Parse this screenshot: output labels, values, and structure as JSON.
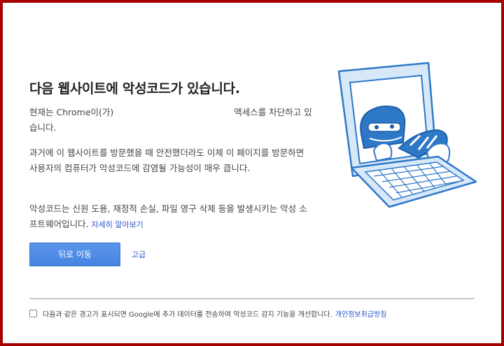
{
  "interstitial": {
    "title": "다음 웹사이트에 악성코드가 있습니다.",
    "paragraph1_part1": "현재는 Chrome이(가)",
    "paragraph1_part2": "액세스를 차단하고 있습니다.",
    "paragraph2": "과거에 이 웹사이트를 방문했을 때 안전했더라도 이제 이 페이지를 방문하면 사용자의 컴퓨터가 악성코드에 감염될 가능성이 매우 큽니다.",
    "paragraph3": "악성코드는 신원 도용, 재정적 손실, 파일 영구 삭제 등을 발생시키는 악성 소프트웨어입니다.",
    "learn_more_label": "자세히 알아보기",
    "back_button_label": "뒤로 이동",
    "advanced_label": "고급",
    "footer_checkbox_text": "다음과 같은 경고가 표시되면 Google에 추가 데이터를 전송하여 악성코드 감지 기능을 개선합니다.",
    "privacy_link_label": "개인정보취급방침",
    "illustration_icon": "malware-laptop-illustration",
    "accent_color": "#4d8ce8",
    "border_color": "#a70000"
  }
}
